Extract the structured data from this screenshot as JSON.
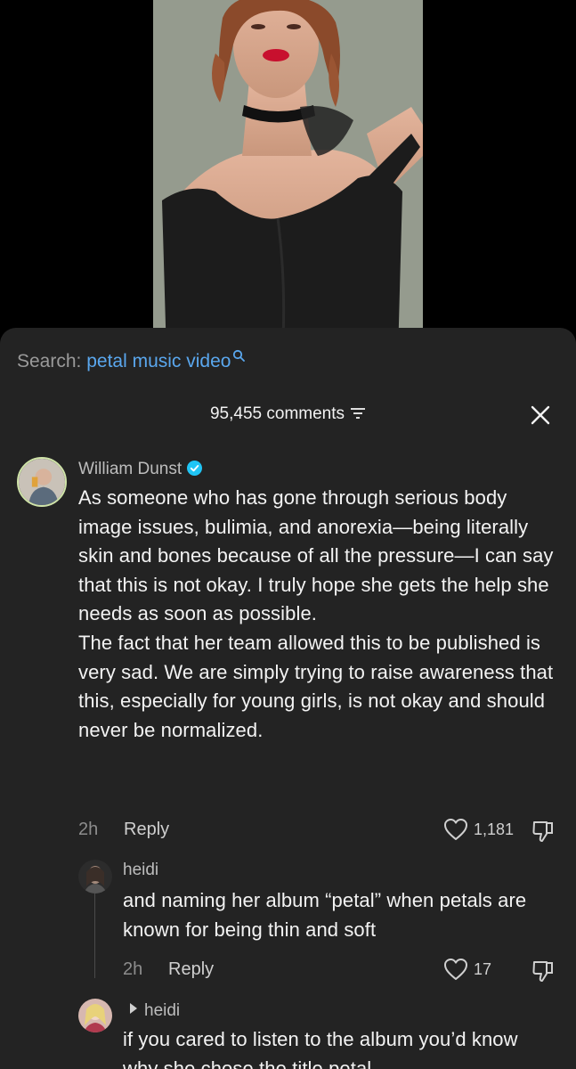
{
  "search": {
    "prefix": "Search:",
    "query": "petal music video"
  },
  "comments_header": {
    "count_label": "95,455 comments"
  },
  "comments": [
    {
      "author": "William Dunst",
      "verified": true,
      "text_p1": "As someone who has gone through serious body image issues, bulimia, and anorexia—being literally skin and bones because of all the pressure—I can say that this is not okay. I truly hope she gets the help she needs as soon as possible.",
      "text_p2": "The fact that her team allowed this to be published is very sad. We are simply trying to raise awareness that this, especially for young girls, is not okay and should never be normalized.",
      "time": "2h",
      "reply_label": "Reply",
      "likes": "1,181"
    },
    {
      "author": "heidi",
      "text": "and naming her album “petal” when petals are known for being thin and soft",
      "time": "2h",
      "reply_label": "Reply",
      "likes": "17"
    },
    {
      "author": "heidi",
      "text": "if you cared to listen to the album you’d know why she chose the title petal"
    }
  ],
  "icons": {
    "search": "search-icon",
    "filter": "filter-icon",
    "close": "close-icon",
    "verified": "verified-badge-icon",
    "like": "heart-icon",
    "dislike": "thumbs-down-icon",
    "reply_to": "reply-arrow-icon"
  },
  "colors": {
    "accent_link": "#5aa7ee",
    "verified": "#20c5f5",
    "sheet_bg": "#232323"
  }
}
